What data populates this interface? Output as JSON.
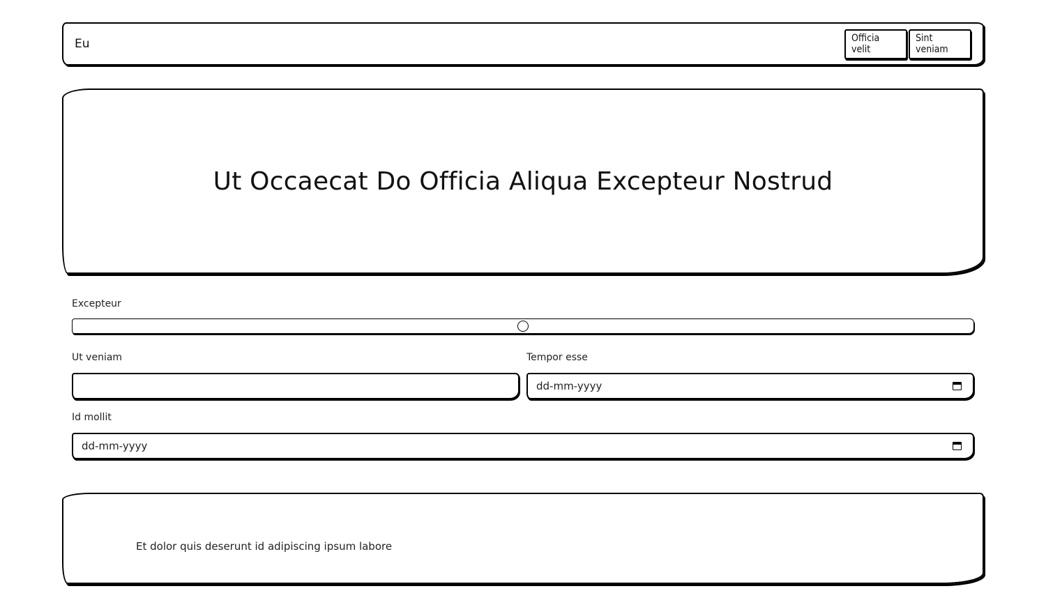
{
  "header": {
    "brand": "Eu",
    "nav": [
      {
        "label": "Officia velit"
      },
      {
        "label": "Sint veniam"
      }
    ]
  },
  "hero": {
    "title": "Ut Occaecat Do Officia Aliqua Excepteur Nostrud"
  },
  "form": {
    "slider": {
      "label": "Excepteur",
      "value": 0.5
    },
    "text_field": {
      "label": "Ut veniam",
      "value": ""
    },
    "date_field_1": {
      "label": "Tempor esse",
      "placeholder": "dd-mm-yyyy",
      "icon": "calendar-icon"
    },
    "date_field_2": {
      "label": "Id mollit",
      "placeholder": "dd-mm-yyyy",
      "icon": "calendar-icon"
    }
  },
  "footer": {
    "text": "Et dolor quis deserunt id adipiscing ipsum labore"
  }
}
